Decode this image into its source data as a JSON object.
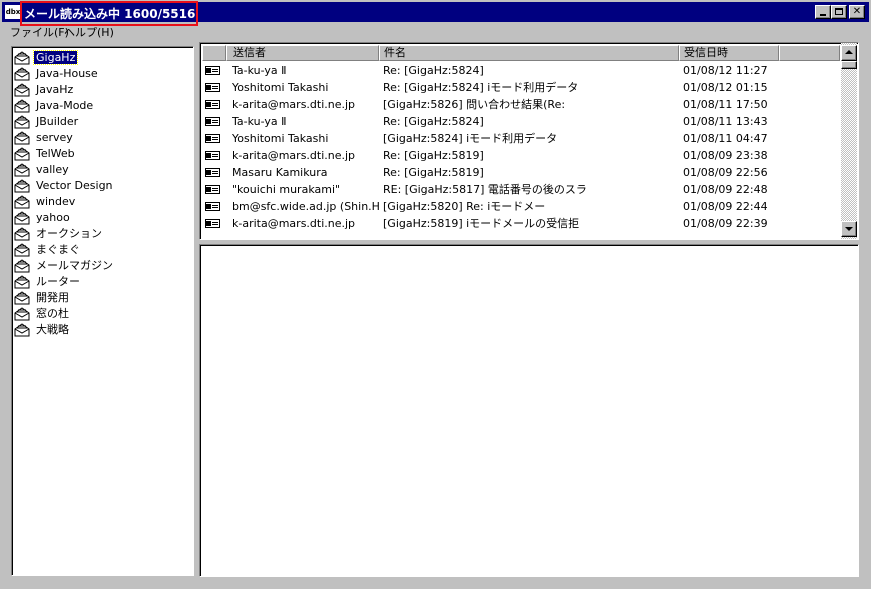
{
  "window": {
    "title": "メール読み込み中 1600/5516",
    "app_icon_text": "dbx"
  },
  "menu": {
    "file": "ファイル(F)",
    "help": "ヘルプ(H)"
  },
  "tree": {
    "items": [
      {
        "label": "GigaHz",
        "selected": true
      },
      {
        "label": "Java-House"
      },
      {
        "label": "JavaHz"
      },
      {
        "label": "Java-Mode"
      },
      {
        "label": "JBuilder"
      },
      {
        "label": "servey"
      },
      {
        "label": "TelWeb"
      },
      {
        "label": "valley"
      },
      {
        "label": "Vector Design"
      },
      {
        "label": "windev"
      },
      {
        "label": "yahoo"
      },
      {
        "label": "オークション"
      },
      {
        "label": "まぐまぐ"
      },
      {
        "label": "メールマガジン"
      },
      {
        "label": "ルーター"
      },
      {
        "label": "開発用"
      },
      {
        "label": "窓の杜"
      },
      {
        "label": "大戦略"
      }
    ]
  },
  "list": {
    "headers": {
      "from": "送信者",
      "subject": "件名",
      "date": "受信日時"
    },
    "rows": [
      {
        "from": "Ta-ku-ya Ⅱ",
        "subject": "Re: [GigaHz:5824]",
        "date": "01/08/12 11:27"
      },
      {
        "from": "Yoshitomi Takashi",
        "subject": "Re: [GigaHz:5824] iモード利用データ",
        "date": "01/08/12 01:15"
      },
      {
        "from": "k-arita@mars.dti.ne.jp",
        "subject": "[GigaHz:5826] 問い合わせ結果(Re:",
        "date": "01/08/11 17:50"
      },
      {
        "from": "Ta-ku-ya Ⅱ",
        "subject": "Re: [GigaHz:5824]",
        "date": "01/08/11 13:43"
      },
      {
        "from": "Yoshitomi Takashi",
        "subject": "[GigaHz:5824] iモード利用データ",
        "date": "01/08/11 04:47"
      },
      {
        "from": "k-arita@mars.dti.ne.jp",
        "subject": "Re: [GigaHz:5819]",
        "date": "01/08/09 23:38"
      },
      {
        "from": "Masaru Kamikura",
        "subject": "Re: [GigaHz:5819]",
        "date": "01/08/09 22:56"
      },
      {
        "from": "\"kouichi murakami\"",
        "subject": "RE: [GigaHz:5817] 電話番号の後のスラ",
        "date": "01/08/09 22:48"
      },
      {
        "from": "bm@sfc.wide.ad.jp (Shin.H)",
        "subject": "[GigaHz:5820] Re: iモードメー",
        "date": "01/08/09 22:44"
      },
      {
        "from": "k-arita@mars.dti.ne.jp",
        "subject": "[GigaHz:5819] iモードメールの受信拒",
        "date": "01/08/09 22:39"
      }
    ]
  },
  "colors": {
    "title_bg": "#000080",
    "highlight_border": "#e8101a",
    "face": "#c0c0c0"
  }
}
